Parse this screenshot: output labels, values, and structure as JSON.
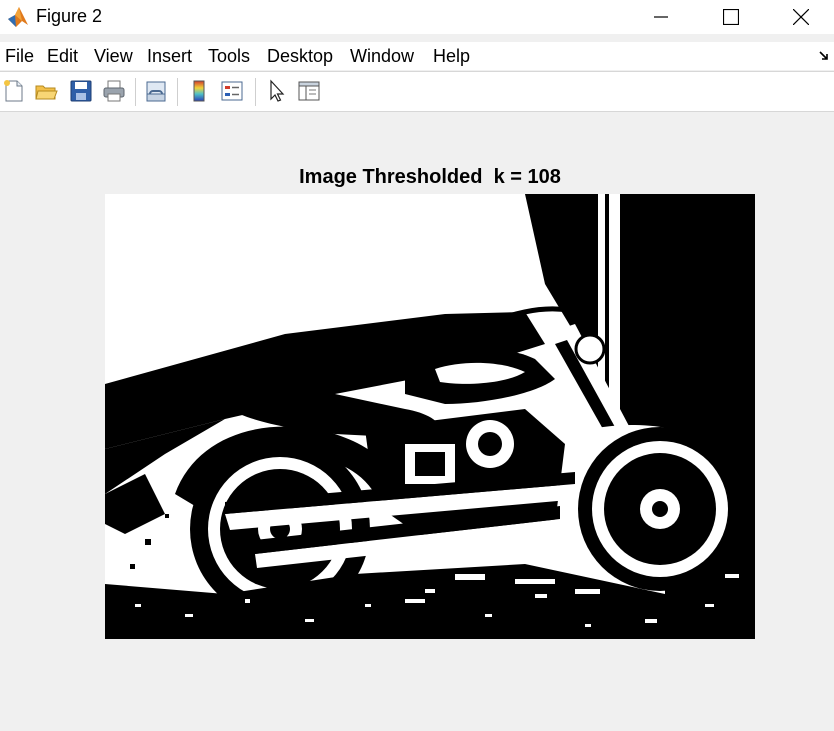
{
  "window": {
    "title": "Figure 2",
    "icon": "matlab-logo-icon"
  },
  "menu": [
    "File",
    "Edit",
    "View",
    "Insert",
    "Tools",
    "Desktop",
    "Window",
    "Help"
  ],
  "toolbar": [
    "new-figure-icon",
    "open-file-icon",
    "save-icon",
    "print-icon",
    "link-plot-icon",
    "colorbar-icon",
    "legend-icon",
    "pointer-icon",
    "property-inspector-icon"
  ],
  "figure": {
    "axes_title": "Image Thresholded  k = 108",
    "image": {
      "type": "binary thresholded photograph",
      "subject": "motorcycle",
      "colors": [
        "#000000",
        "#ffffff"
      ]
    }
  }
}
